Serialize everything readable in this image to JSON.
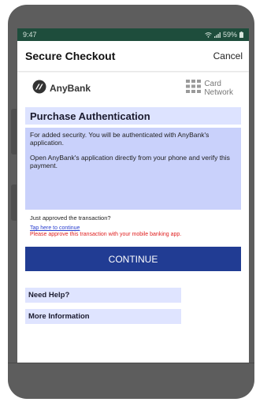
{
  "status_bar": {
    "time": "9:47",
    "battery": "59%"
  },
  "header": {
    "title": "Secure Checkout",
    "cancel_label": "Cancel"
  },
  "logos": {
    "bank_name": "AnyBank",
    "network_line1": "Card",
    "network_line2": "Network"
  },
  "auth": {
    "title": "Purchase Authentication",
    "paragraph1": "For added security. You will be authenticated with AnyBank's application.",
    "paragraph2": "Open AnyBank's application directly from your phone and verify this payment."
  },
  "approval": {
    "question": "Just approved the transaction?",
    "link": "Tap here to continue",
    "message": "Please approve this transaction with your mobile banking app."
  },
  "continue_label": "CONTINUE",
  "help": {
    "need_help": "Need Help?",
    "more_info": "More Information"
  },
  "colors": {
    "status_bar": "#1e4d3c",
    "primary_button": "#213c93",
    "panel": "#c9d1fb",
    "panel_light": "#dde3ff",
    "link": "#2a3fcf",
    "warning": "#e02020"
  }
}
